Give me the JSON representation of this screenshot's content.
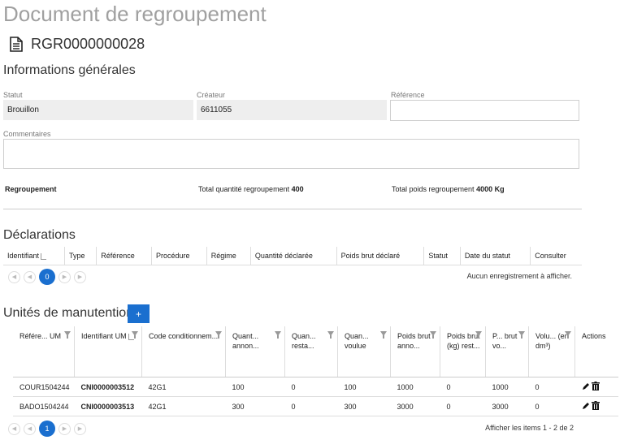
{
  "header": {
    "title": "Document de regroupement",
    "doc_id": "RGR0000000028"
  },
  "general": {
    "section_title": "Informations générales",
    "statut_label": "Statut",
    "statut_value": "Brouillon",
    "createur_label": "Créateur",
    "createur_value": "6611055",
    "reference_label": "Référence",
    "reference_value": "",
    "commentaires_label": "Commentaires",
    "commentaires_value": ""
  },
  "summary": {
    "label": "Regroupement",
    "qty_label": "Total quantité regroupement",
    "qty_value": "400",
    "weight_label": "Total poids regroupement",
    "weight_value": "4000 Kg"
  },
  "declarations": {
    "section_title": "Déclarations",
    "columns": [
      "Identifiant",
      "Type",
      "Référence",
      "Procédure",
      "Régime",
      "Quantité déclarée",
      "Poids brut déclaré",
      "Statut",
      "Date du statut",
      "Consulter"
    ],
    "page": "0",
    "empty_message": "Aucun enregistrement à afficher."
  },
  "um": {
    "section_title": "Unités de manutention",
    "add_label": "+",
    "columns": [
      "Référe... UM",
      "Identifiant UM",
      "Code conditionnem...",
      "Quant... annon...",
      "Quan... resta...",
      "Quan... voulue",
      "Poids brut anno...",
      "Poids brut (kg) rest...",
      "P... brut vo...",
      "Volu... (en dm³)",
      "Actions"
    ],
    "rows": [
      [
        "COUR1504244",
        "CNI0000003512",
        "42G1",
        "100",
        "0",
        "100",
        "1000",
        "0",
        "1000",
        "0"
      ],
      [
        "BADO1504244",
        "CNI0000003513",
        "42G1",
        "300",
        "0",
        "300",
        "3000",
        "0",
        "3000",
        "0"
      ]
    ],
    "page": "1",
    "items_info": "Afficher les items 1 - 2 de 2"
  },
  "icons": {
    "doc": "document-icon",
    "edit": "pencil-icon",
    "delete": "trash-icon"
  },
  "colors": {
    "accent": "#1a6fcf"
  }
}
